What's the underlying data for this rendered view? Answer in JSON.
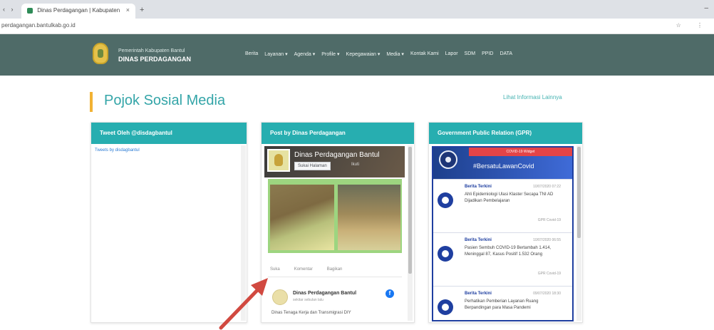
{
  "browser": {
    "tab_title": "Dinas Perdagangan | Kabupaten",
    "tab_close": "×",
    "new_tab": "+",
    "url": "perdagangan.bantulkab.go.id",
    "window_controls": "–",
    "toolbar_icons": "☆ ⋮"
  },
  "site": {
    "org_sub": "Pemerintah Kabupaten Bantul",
    "org_name": "DINAS PERDAGANGAN",
    "menu": [
      "Berita",
      "Layanan ▾",
      "Agenda ▾",
      "Profile ▾",
      "Kepegawaian ▾",
      "Media ▾",
      "Kontak Kami",
      "Lapor",
      "SDM",
      "PPID",
      "DATA"
    ]
  },
  "page": {
    "title": "Pojok Sosial Media",
    "more_link": "Lihat Informasi Lainnya"
  },
  "cards": {
    "twitter": {
      "header": "Tweet Oleh @disdagbantul",
      "tweets_link": "Tweets by disdagbantul"
    },
    "facebook": {
      "header": "Post by Dinas Perdagangan",
      "page_name": "Dinas Perdagangan Bantul",
      "like_label": "Sukai Halaman",
      "follow_label": "Ikuti",
      "actions": [
        "Suka",
        "Komentar",
        "Bagikan"
      ],
      "post_name": "Dinas Perdagangan Bantul",
      "post_sub": "sekitar sebulan lalu",
      "post_text": "Dinas Tenaga Kerja dan Transmigrasi DIY"
    },
    "gpr": {
      "header": "Government Public Relation (GPR)",
      "banner_tag": "COVID-19 Widget",
      "hashtag": "#BersatuLawanCovid",
      "items": [
        {
          "label": "Berita Terkini",
          "date": "10/07/2020 07:22",
          "title": "Ahli Epidemiologi Ulasi Klaster Secapa TNI AD Dijadikan Pembelajaran",
          "source": "GPR Covid-19"
        },
        {
          "label": "Berita Terkini",
          "date": "10/07/2020 06:55",
          "title": "Pasien Sembuh COVID-19 Bertambah 1.414, Meninggal 87, Kasus Positif 1.532 Orang",
          "source": "GPR Covid-19"
        },
        {
          "label": "Berita Terkini",
          "date": "09/07/2020 18:30",
          "title": "Perhatikan Pemberian Layanan Ruang Berpandingan para Masa Pandemi",
          "source": "GPR Covid-19"
        }
      ]
    }
  },
  "colors": {
    "nav_bg": "#4f6b68",
    "accent": "#27aeb0",
    "title": "#34a5a8",
    "arrow": "#d14940"
  }
}
